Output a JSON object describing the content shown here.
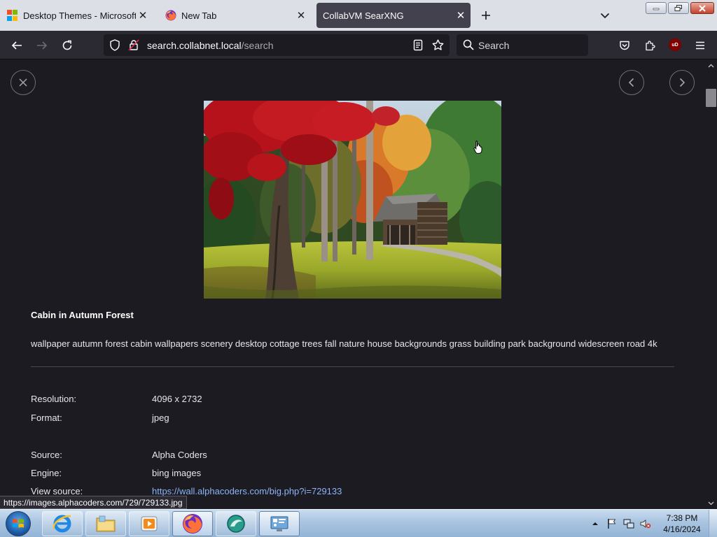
{
  "browser": {
    "tabs": [
      {
        "title": "Desktop Themes - Microsoft Su",
        "favicon": "microsoft-logo-icon",
        "active": false
      },
      {
        "title": "New Tab",
        "favicon": "firefox-icon",
        "active": false
      },
      {
        "title": "CollabVM SearXNG",
        "favicon": "",
        "active": true
      }
    ],
    "url": {
      "host": "search.collabnet.local",
      "path": "/search"
    },
    "search_placeholder": "Search",
    "extension_badge": "uD"
  },
  "viewer": {
    "title": "Cabin in Autumn Forest",
    "description": "wallpaper autumn forest cabin wallpapers scenery desktop cottage trees fall nature house backgrounds grass building park background widescreen road 4k",
    "fields": [
      {
        "label": "Resolution:",
        "value": "4096 x 2732"
      },
      {
        "label": "Format:",
        "value": "jpeg"
      },
      {
        "label": "Source:",
        "value": "Alpha Coders"
      },
      {
        "label": "Engine:",
        "value": "bing images"
      },
      {
        "label": "View source:",
        "value": "https://wall.alphacoders.com/big.php?i=729133"
      }
    ],
    "hover_url": "https://images.alphacoders.com/729/729133.jpg"
  },
  "taskbar": {
    "items": [
      "internet-explorer-icon",
      "file-explorer-icon",
      "media-player-icon",
      "firefox-icon",
      "app-icon",
      "control-panel-icon"
    ],
    "time": "7:38 PM",
    "date": "4/16/2024"
  },
  "colors": {
    "page_bg": "#1c1b22",
    "toolbar_bg": "#2b2a33",
    "tabstrip_bg": "#dcdfe6",
    "link": "#8ab4f8"
  }
}
